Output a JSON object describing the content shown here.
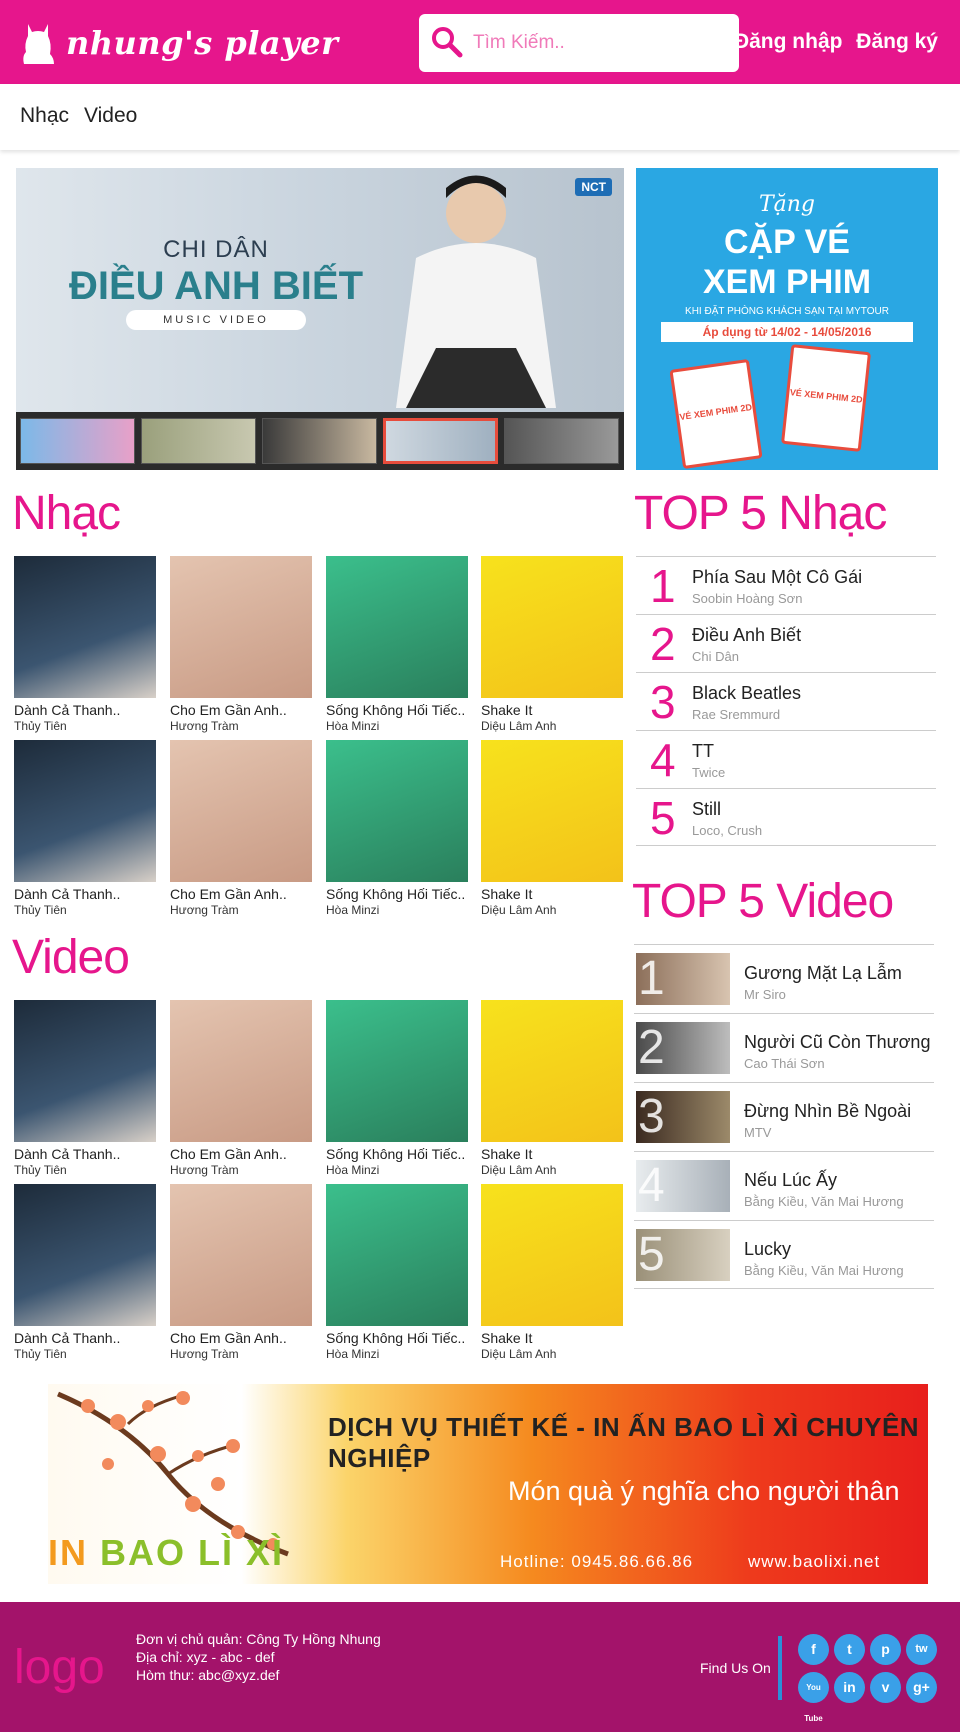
{
  "header": {
    "logo_text": "nhung's player",
    "search_placeholder": "Tìm Kiếm..",
    "login": "Đăng nhập",
    "register": "Đăng ký"
  },
  "nav": {
    "items": [
      "Nhạc",
      "Video"
    ]
  },
  "main_banner": {
    "artist": "CHI DÂN",
    "title": "ĐIỀU ANH BIẾT",
    "subtitle": "MUSIC VIDEO",
    "badge": "NCT"
  },
  "side_banner": {
    "small": "Tặng",
    "big_line1": "CẶP VÉ",
    "big_line2": "XEM PHIM",
    "line": "KHI ĐẶT PHÒNG KHÁCH SẠN TẠI MYTOUR",
    "date": "Áp dụng từ 14/02 - 14/05/2016",
    "ticket_label": "VÉ XEM PHIM 2D"
  },
  "sections": {
    "music": "Nhạc",
    "video": "Video",
    "top_music": "TOP 5 Nhạc",
    "top_video": "TOP 5 Video"
  },
  "albums": [
    {
      "title": "Dành Cả Thanh..",
      "artist": "Thủy Tiên"
    },
    {
      "title": "Cho Em Gần Anh..",
      "artist": "Hương Tràm"
    },
    {
      "title": "Sống Không Hối Tiếc..",
      "artist": "Hòa Minzi"
    },
    {
      "title": "Shake It",
      "artist": "Diệu Lâm Anh"
    }
  ],
  "top_music": [
    {
      "rank": "1",
      "title": "Phía Sau Một Cô Gái",
      "artist": "Soobin Hoàng Sơn"
    },
    {
      "rank": "2",
      "title": "Điều Anh Biết",
      "artist": "Chi Dân"
    },
    {
      "rank": "3",
      "title": "Black Beatles",
      "artist": "Rae Sremmurd"
    },
    {
      "rank": "4",
      "title": "TT",
      "artist": "Twice"
    },
    {
      "rank": "5",
      "title": "Still",
      "artist": "Loco, Crush"
    }
  ],
  "top_video": [
    {
      "rank": "1",
      "title": "Gương Mặt Lạ Lẫm",
      "artist": "Mr Siro"
    },
    {
      "rank": "2",
      "title": "Người Cũ Còn Thương",
      "artist": "Cao Thái Sơn"
    },
    {
      "rank": "3",
      "title": "Đừng Nhìn Bề Ngoài",
      "artist": "MTV"
    },
    {
      "rank": "4",
      "title": "Nếu Lúc Ấy",
      "artist": "Bằng Kiều, Văn Mai Hương"
    },
    {
      "rank": "5",
      "title": "Lucky",
      "artist": "Bằng Kiều, Văn Mai Hương"
    }
  ],
  "ad": {
    "headline": "DỊCH VỤ THIẾT KẾ - IN ẤN BAO LÌ XÌ CHUYÊN NGHIỆP",
    "sub": "Món quà ý nghĩa cho người thân",
    "hotline": "Hotline: 0945.86.66.86",
    "web": "www.baolixi.net",
    "brand_a": "IN ",
    "brand_b": "BAO LÌ XÌ"
  },
  "footer": {
    "logo": "logo",
    "info1": "Đơn vị chủ quản: Công Ty Hồng Nhung",
    "info2": "Địa chỉ: xyz - abc - def",
    "info3": "Hòm thư: abc@xyz.def",
    "find_us": "Find Us On",
    "social": [
      "f",
      "t",
      "p",
      "tw",
      "You Tube",
      "in",
      "v",
      "g+"
    ]
  },
  "colors": {
    "brand": "#e6168c",
    "footer": "#a3136a",
    "social": "#3aa0e8"
  }
}
